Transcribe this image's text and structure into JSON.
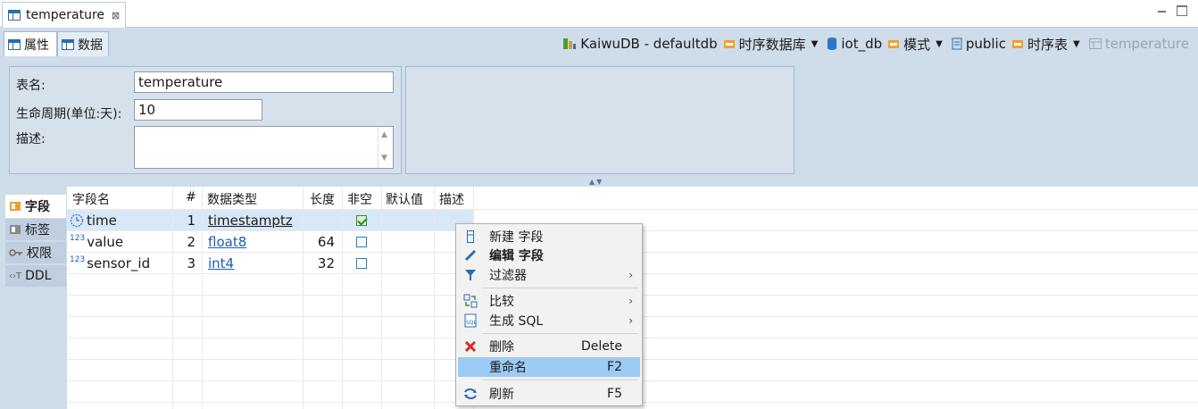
{
  "editor_tab": {
    "title": "temperature",
    "close": "⊠"
  },
  "subtabs": {
    "properties": "属性",
    "data": "数据"
  },
  "breadcrumb": {
    "connection": "KaiwuDB - defaultdb",
    "db_type": "时序数据库",
    "database": "iot_db",
    "schema_folder": "模式",
    "schema": "public",
    "table_type": "时序表",
    "table": "temperature"
  },
  "properties": {
    "table_name_label": "表名:",
    "table_name_value": "temperature",
    "lifecycle_label": "生命周期(单位:天):",
    "lifecycle_value": "10",
    "description_label": "描述:"
  },
  "vtabs": {
    "fields": "字段",
    "tags": "标签",
    "permissions": "权限",
    "ddl": "DDL"
  },
  "table": {
    "headers": {
      "name": "字段名",
      "index": "#",
      "type": "数据类型",
      "length": "长度",
      "not_null": "非空",
      "default": "默认值",
      "description": "描述"
    },
    "rows": [
      {
        "name": "time",
        "index": "1",
        "type": "timestamptz",
        "length": "",
        "not_null": true,
        "icon": "clock-icon"
      },
      {
        "name": "value",
        "index": "2",
        "type": "float8",
        "length": "64",
        "not_null": false,
        "icon": "123-icon"
      },
      {
        "name": "sensor_id",
        "index": "3",
        "type": "int4",
        "length": "32",
        "not_null": false,
        "icon": "123-icon"
      }
    ],
    "number_glyph": "123"
  },
  "context_menu": {
    "new_field": "新建 字段",
    "edit_field_1": "编辑",
    "edit_field_2": "字段",
    "filter": "过滤器",
    "compare": "比较",
    "generate_sql": "生成 SQL",
    "delete": "删除",
    "delete_key": "Delete",
    "rename": "重命名",
    "rename_key": "F2",
    "refresh": "刷新",
    "refresh_key": "F5"
  },
  "colors": {
    "panel_bg": "#cfdcea",
    "selection": "#d9e8f7",
    "menu_highlight": "#9ccbf5",
    "link": "#1a5fb4"
  }
}
